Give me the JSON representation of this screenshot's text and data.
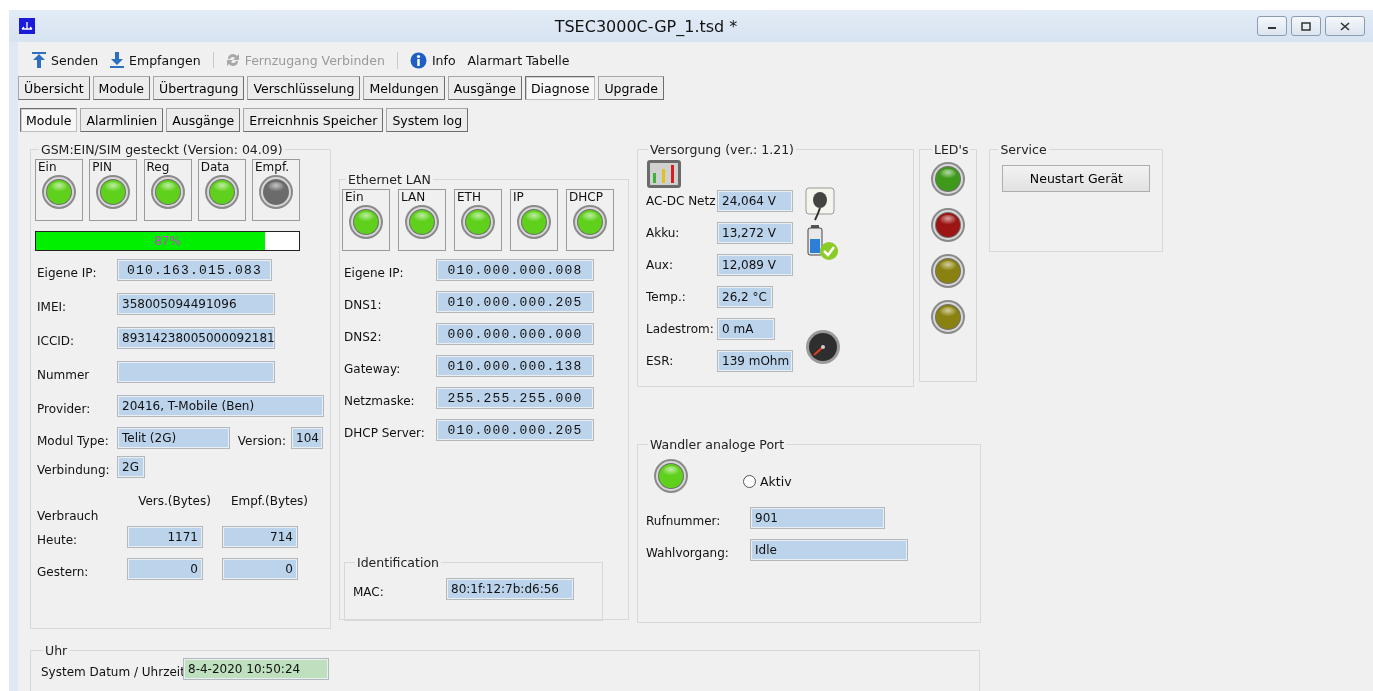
{
  "window": {
    "title": "TSEC3000C-GP_1.tsd  *"
  },
  "toolbar": [
    [
      {
        "kind": "upload",
        "label": "Senden",
        "disabled": false
      },
      {
        "kind": "download",
        "label": "Empfangen",
        "disabled": false
      }
    ],
    [
      {
        "kind": "sync",
        "label": "Fernzugang Verbinden",
        "disabled": true
      }
    ],
    [
      {
        "kind": "info",
        "label": "Info",
        "disabled": false
      },
      {
        "kind": "none",
        "label": "Alarmart Tabelle",
        "disabled": false
      }
    ]
  ],
  "tabs": [
    {
      "label": "Übersicht",
      "selected": false
    },
    {
      "label": "Module",
      "selected": false
    },
    {
      "label": "Übertragung",
      "selected": false
    },
    {
      "label": "Verschlüsselung",
      "selected": false
    },
    {
      "label": "Meldungen",
      "selected": false
    },
    {
      "label": "Ausgänge",
      "selected": false
    },
    {
      "label": "Diagnose",
      "selected": true
    },
    {
      "label": "Upgrade",
      "selected": false
    }
  ],
  "subtabs": [
    {
      "label": "Module",
      "selected": true
    },
    {
      "label": "Alarmlinien",
      "selected": false
    },
    {
      "label": "Ausgänge",
      "selected": false
    },
    {
      "label": "Erreicnhnis Speicher",
      "selected": false
    },
    {
      "label": "System log",
      "selected": false
    }
  ],
  "gsm": {
    "title": "GSM:EIN/SIM gesteckt (Version: 04.09)",
    "indicators": [
      {
        "label": "Ein",
        "on": true
      },
      {
        "label": "PIN",
        "on": true
      },
      {
        "label": "Reg",
        "on": true
      },
      {
        "label": "Data",
        "on": true
      },
      {
        "label": "Empf.",
        "on": false
      }
    ],
    "signal": {
      "level": 0.87,
      "reading": "87%"
    },
    "fields": [
      {
        "label": "Eigene IP:",
        "value": "010.163.015.083",
        "kind": "ip"
      },
      {
        "label": "IMEI:",
        "value": "358005094491096",
        "kind": "short"
      },
      {
        "label": "ICCID:",
        "value": "89314238005000092181",
        "kind": "short"
      },
      {
        "label": "Nummer",
        "kind": "short"
      },
      {
        "label": "Provider:",
        "value": "20416, T-Mobile (Ben)",
        "kind": "wide"
      }
    ],
    "modul": {
      "label": "Modul Type:",
      "value": "Telit  (2G)",
      "version_label": "Version:",
      "version": "104"
    },
    "verbindung": {
      "label": "Verbindung:",
      "value": "2G"
    },
    "usage": {
      "title": "Verbrauch",
      "columns": [
        "Vers.(Bytes)",
        "Empf.(Bytes)"
      ],
      "rows": [
        {
          "label": "Heute:",
          "values": [
            "1171",
            "714"
          ]
        },
        {
          "label": "Gestern:",
          "values": [
            "0",
            "0"
          ]
        }
      ]
    }
  },
  "ethernet": {
    "title": "Ethernet LAN",
    "indicators": [
      {
        "label": "Ein",
        "on": true
      },
      {
        "label": "LAN",
        "on": true
      },
      {
        "label": "ETH",
        "on": true
      },
      {
        "label": "IP",
        "on": true
      },
      {
        "label": "DHCP",
        "on": true
      }
    ],
    "fields": [
      {
        "label": "Eigene IP:",
        "value": "010.000.000.008"
      },
      {
        "label": "DNS1:",
        "value": "010.000.000.205"
      },
      {
        "label": "DNS2:",
        "value": "000.000.000.000"
      },
      {
        "label": "Gateway:",
        "value": "010.000.000.138"
      },
      {
        "label": "Netzmaske:",
        "value": "255.255.255.000"
      },
      {
        "label": "DHCP Server:",
        "value": "010.000.000.205"
      }
    ],
    "identification": {
      "title": "Identification",
      "label": "MAC:",
      "value": "80:1f:12:7b:d6:56"
    }
  },
  "versorgung": {
    "title": "Versorgung (ver.: 1.21)",
    "rows": [
      {
        "label": "AC-DC Netz",
        "value": "24,064 V",
        "kind": "wide"
      },
      {
        "label": "Akku:",
        "value": "13,272 V",
        "kind": "wide"
      },
      {
        "label": "Aux:",
        "value": "12,089 V",
        "kind": "wide"
      },
      {
        "label": "Temp.:",
        "value": "26,2 °C",
        "kind": "narrow"
      },
      {
        "label": "Ladestrom:",
        "value": "0 mA",
        "kind": "medium"
      },
      {
        "label": "ESR:",
        "value": "139 mOhm",
        "kind": "wide"
      }
    ]
  },
  "leds": {
    "title": "LED's",
    "items": [
      {
        "color": "#3f9a1c"
      },
      {
        "color": "#9c1414"
      },
      {
        "color": "#8a8210"
      },
      {
        "color": "#8a8210"
      }
    ]
  },
  "service": {
    "title": "Service",
    "button": "Neustart Gerät"
  },
  "wandler": {
    "title": "Wandler analoge Port",
    "lamp_on": true,
    "radio": {
      "label": "Aktiv",
      "checked": false
    },
    "fields": [
      {
        "label": "Rufnummer:",
        "value": "901",
        "kind": "medium"
      },
      {
        "label": "Wahlvorgang:",
        "value": "Idle",
        "kind": "wide"
      }
    ]
  },
  "uhr": {
    "title": "Uhr",
    "label": "System Datum / Uhrzeit",
    "value": "8-4-2020 10:50:24"
  }
}
